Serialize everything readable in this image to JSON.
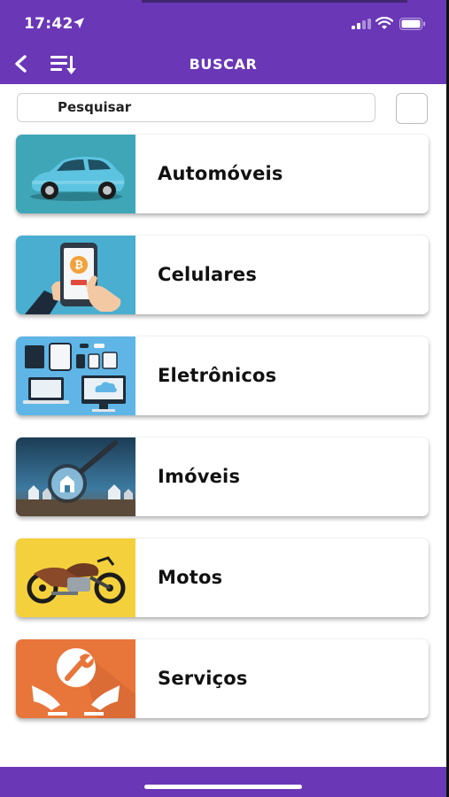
{
  "status_bar": {
    "time": "17:42"
  },
  "header": {
    "title": "BUSCAR",
    "back_icon": "chevron-left-icon",
    "sort_icon": "sort-descending-icon"
  },
  "search": {
    "placeholder": "Pesquisar"
  },
  "categories": [
    {
      "label": "Automóveis",
      "image": "car-image"
    },
    {
      "label": "Celulares",
      "image": "smartphone-image"
    },
    {
      "label": "Eletrônicos",
      "image": "electronics-image"
    },
    {
      "label": "Imóveis",
      "image": "house-magnifier-image"
    },
    {
      "label": "Motos",
      "image": "motorcycle-image"
    },
    {
      "label": "Serviços",
      "image": "hands-wrench-image"
    }
  ],
  "colors": {
    "header": "#6a37b7",
    "card_text": "#111111"
  }
}
